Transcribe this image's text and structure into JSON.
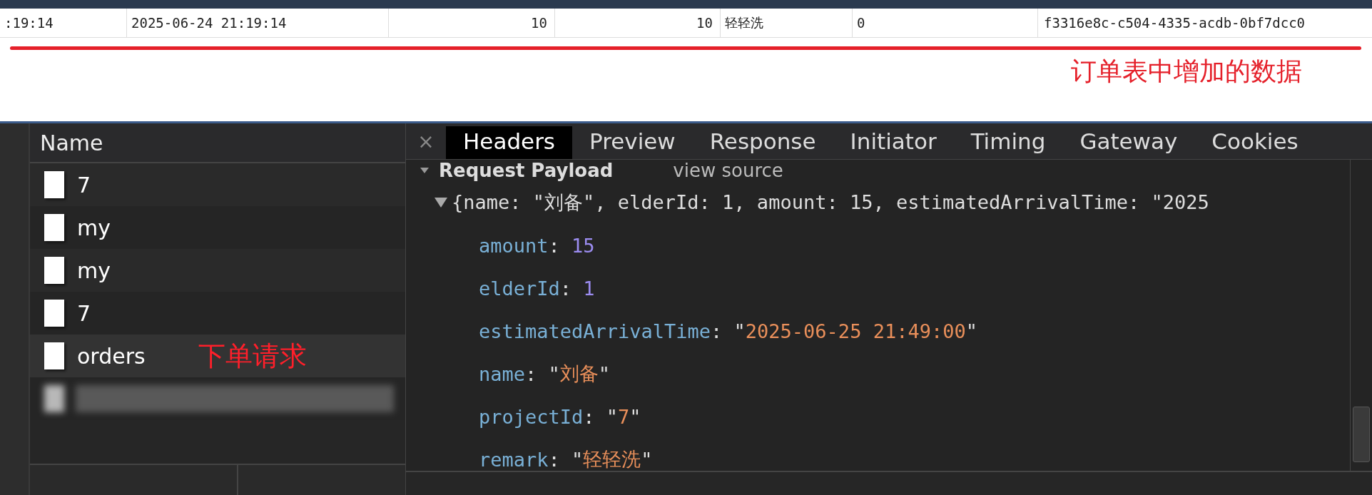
{
  "db_row": {
    "cells": [
      ":19:14",
      "2025-06-24 21:19:14",
      "10",
      "10",
      "轻轻洗",
      "0",
      "f3316e8c-c504-4335-acdb-0bf7dcc0"
    ]
  },
  "annotations": {
    "table": "订单表中增加的数据",
    "request": "下单请求"
  },
  "network": {
    "name_header": "Name",
    "requests": [
      {
        "name": "7",
        "selected": false
      },
      {
        "name": "my",
        "selected": false
      },
      {
        "name": "my",
        "selected": false
      },
      {
        "name": "7",
        "selected": false
      },
      {
        "name": "orders",
        "selected": true
      }
    ],
    "tabs": [
      {
        "label": "Headers",
        "selected": true
      },
      {
        "label": "Preview",
        "selected": false
      },
      {
        "label": "Response",
        "selected": false
      },
      {
        "label": "Initiator",
        "selected": false
      },
      {
        "label": "Timing",
        "selected": false
      },
      {
        "label": "Gateway",
        "selected": false
      },
      {
        "label": "Cookies",
        "selected": false
      }
    ],
    "close": "×",
    "payload": {
      "title": "Request Payload",
      "view_source": "view source",
      "expanded": true,
      "summary": "{name: \"刘备\", elderId: 1, amount: 15, estimatedArrivalTime: \"2025",
      "fields": [
        {
          "key": "amount",
          "separator": ":",
          "value": "15",
          "kind": "number"
        },
        {
          "key": "elderId",
          "separator": ":",
          "value": "1",
          "kind": "number"
        },
        {
          "key": "estimatedArrivalTime",
          "separator": ":",
          "value": "\"2025-06-25 21:49:00\"",
          "kind": "string"
        },
        {
          "key": "name",
          "separator": ":",
          "value": "\"刘备\"",
          "kind": "string"
        },
        {
          "key": "projectId",
          "separator": ":",
          "value": "\"7\"",
          "kind": "string"
        },
        {
          "key": "remark",
          "separator": ":",
          "value": "\"轻轻洗\"",
          "kind": "string"
        }
      ]
    }
  }
}
